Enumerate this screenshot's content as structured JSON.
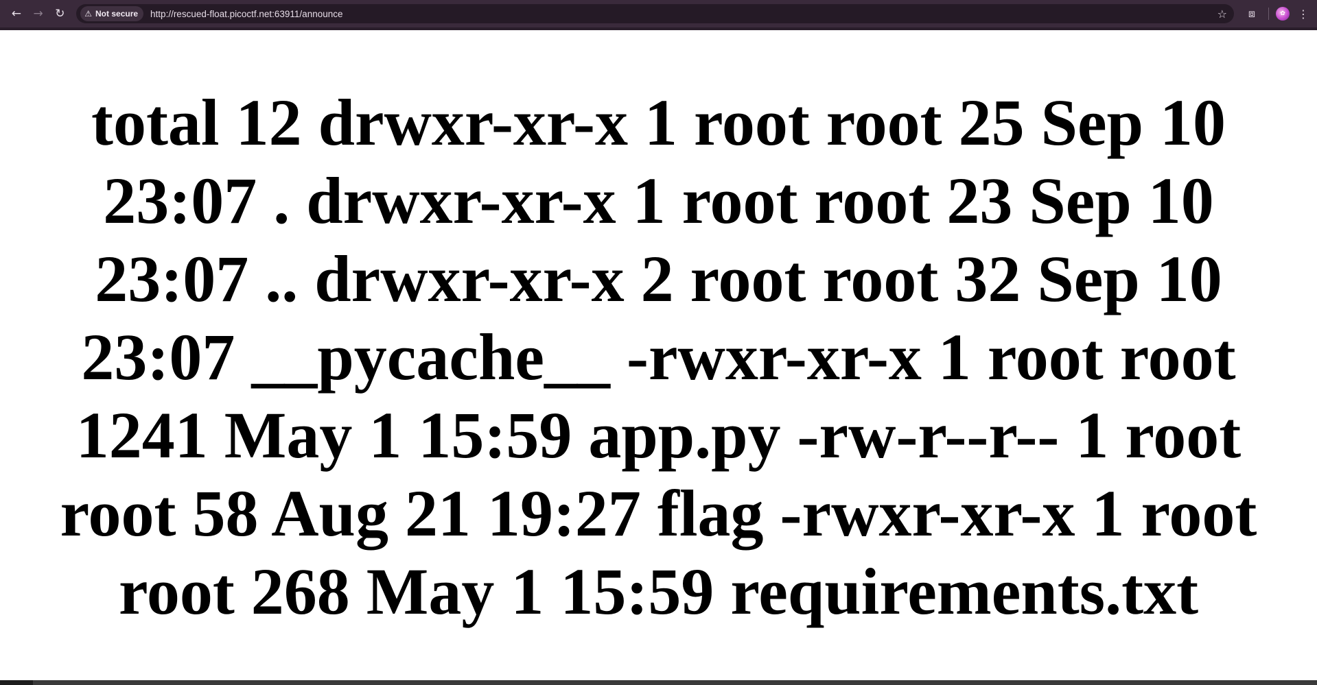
{
  "browser": {
    "security_label": "Not secure",
    "url": "http://rescued-float.picoctf.net:63911/announce",
    "icons": {
      "back": "arrow-left-icon",
      "forward": "arrow-right-icon",
      "reload": "reload-icon",
      "warning": "warning-triangle-icon",
      "bookmark": "star-icon",
      "extensions": "puzzle-icon",
      "profile": "avatar-icon",
      "menu": "kebab-menu-icon"
    },
    "colors": {
      "toolbar": "#3a2a3b",
      "omnibox": "#251a26"
    }
  },
  "page": {
    "announcement": "total 12 drwxr-xr-x 1 root root 25 Sep 10 23:07 . drwxr-xr-x 1 root root 23 Sep 10 23:07 .. drwxr-xr-x 2 root root 32 Sep 10 23:07 __pycache__ -rwxr-xr-x 1 root root 1241 May 1 15:59 app.py -rw-r--r-- 1 root root 58 Aug 21 19:27 flag -rwxr-xr-x 1 root root 268 May 1 15:59 requirements.txt"
  }
}
